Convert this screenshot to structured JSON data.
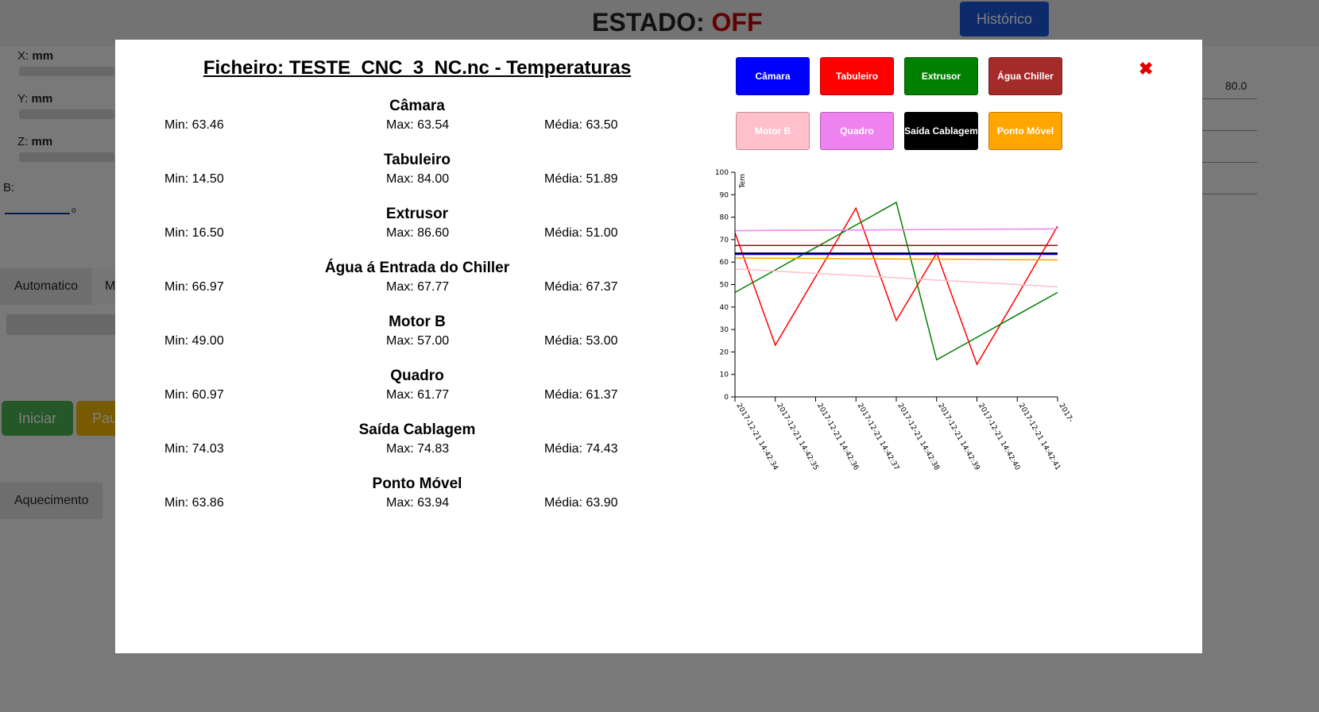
{
  "background": {
    "status_label": "ESTADO:",
    "status_value": "OFF",
    "history_button": "Histórico",
    "axes": [
      {
        "name": "X:",
        "unit": "mm"
      },
      {
        "name": "Y:",
        "unit": "mm"
      },
      {
        "name": "Z:",
        "unit": "mm"
      }
    ],
    "b_label": "B:",
    "b_unit": "o",
    "right_value": "80.0",
    "tabs": {
      "auto": "Automatico",
      "manual": "M",
      "heat": "Aquecimento"
    },
    "start_button": "Iniciar",
    "pause_button": "Pau"
  },
  "modal": {
    "title": "Ficheiro: TESTE_CNC_3_NC.nc - Temperaturas",
    "close_symbol": "✖",
    "sensors": [
      {
        "name": "Câmara",
        "min": "Min: 63.46",
        "max": "Max: 63.54",
        "avg": "Média: 63.50"
      },
      {
        "name": "Tabuleiro",
        "min": "Min: 14.50",
        "max": "Max: 84.00",
        "avg": "Média: 51.89"
      },
      {
        "name": "Extrusor",
        "min": "Min: 16.50",
        "max": "Max: 86.60",
        "avg": "Média: 51.00"
      },
      {
        "name": "Água á Entrada do Chiller",
        "min": "Min: 66.97",
        "max": "Max: 67.77",
        "avg": "Média: 67.37"
      },
      {
        "name": "Motor B",
        "min": "Min: 49.00",
        "max": "Max: 57.00",
        "avg": "Média: 53.00"
      },
      {
        "name": "Quadro",
        "min": "Min: 60.97",
        "max": "Max: 61.77",
        "avg": "Média: 61.37"
      },
      {
        "name": "Saída Cablagem",
        "min": "Min: 74.03",
        "max": "Max: 74.83",
        "avg": "Média: 74.43"
      },
      {
        "name": "Ponto Móvel",
        "min": "Min: 63.86",
        "max": "Max: 63.94",
        "avg": "Média: 63.90"
      }
    ],
    "series_buttons": [
      {
        "label": "Câmara",
        "color": "#0000ff",
        "text_color": "#ffffff"
      },
      {
        "label": "Tabuleiro",
        "color": "#ff0000",
        "text_color": "#ffffff"
      },
      {
        "label": "Extrusor",
        "color": "#008000",
        "text_color": "#ffffff"
      },
      {
        "label": "Água Chiller",
        "color": "#a52a2a",
        "text_color": "#ffffff"
      },
      {
        "label": "Motor B",
        "color": "#ffc0cb",
        "text_color": "#ffffff"
      },
      {
        "label": "Quadro",
        "color": "#ee82ee",
        "text_color": "#ffffff"
      },
      {
        "label": "Saída Cablagem",
        "color": "#000000",
        "text_color": "#ffffff"
      },
      {
        "label": "Ponto Móvel",
        "color": "#ffa500",
        "text_color": "#ffffff"
      }
    ]
  },
  "chart_data": {
    "type": "line",
    "ylabel": "Tem",
    "ylim": [
      0,
      100
    ],
    "yticks": [
      0,
      10,
      20,
      30,
      40,
      50,
      60,
      70,
      80,
      90,
      100
    ],
    "x": [
      "2017-12-21 14:42:34",
      "2017-12-21 14:42:35",
      "2017-12-21 14:42:36",
      "2017-12-21 14:42:37",
      "2017-12-21 14:42:38",
      "2017-12-21 14:42:39",
      "2017-12-21 14:42:40",
      "2017-12-21 14:42:41",
      "2017-12-21 14:42:42"
    ],
    "x_tick_labels": [
      "2017-12-21 14:42:34",
      "2017-12-21 14:42:35",
      "2017-12-21 14:42:36",
      "2017-12-21 14:42:37",
      "2017-12-21 14:42:38",
      "2017-12-21 14:42:39",
      "2017-12-21 14:42:40",
      "2017-12-21 14:42:41",
      "2017-"
    ],
    "series": [
      {
        "name": "Câmara",
        "color": "#0000ff",
        "width": 2,
        "values": [
          63.5,
          63.5,
          63.5,
          63.5,
          63.5,
          63.5,
          63.5,
          63.5,
          63.5
        ]
      },
      {
        "name": "Tabuleiro",
        "color": "#ff0000",
        "width": 1.5,
        "values": [
          73,
          23,
          53.5,
          84,
          34,
          64,
          14.5,
          45,
          76
        ]
      },
      {
        "name": "Extrusor",
        "color": "#008000",
        "width": 1.5,
        "values": [
          46.5,
          56.5,
          66.5,
          76.5,
          86.6,
          16.5,
          26.5,
          36.5,
          46.5
        ]
      },
      {
        "name": "Água á Entrada do Chiller",
        "color": "#8b1a1a",
        "width": 1.5,
        "values": [
          67.4,
          67.4,
          67.4,
          67.4,
          67.4,
          67.4,
          67.4,
          67.4,
          67.4
        ]
      },
      {
        "name": "Motor B",
        "color": "#ffc0cb",
        "width": 1.5,
        "values": [
          57,
          56,
          55,
          54,
          53,
          52,
          51,
          50,
          49
        ]
      },
      {
        "name": "Quadro",
        "color": "#ee82ee",
        "width": 1.5,
        "values": [
          74,
          74.1,
          74.2,
          74.3,
          74.4,
          74.5,
          74.6,
          74.7,
          74.8
        ]
      },
      {
        "name": "Saída Cablagem",
        "color": "#000000",
        "width": 2,
        "values": [
          63.9,
          63.9,
          63.9,
          63.9,
          63.9,
          63.9,
          63.9,
          63.9,
          63.9
        ]
      },
      {
        "name": "Ponto Móvel",
        "color": "#ffa500",
        "width": 1.5,
        "values": [
          61.8,
          61.7,
          61.6,
          61.5,
          61.4,
          61.3,
          61.2,
          61.1,
          61.0
        ]
      }
    ]
  }
}
